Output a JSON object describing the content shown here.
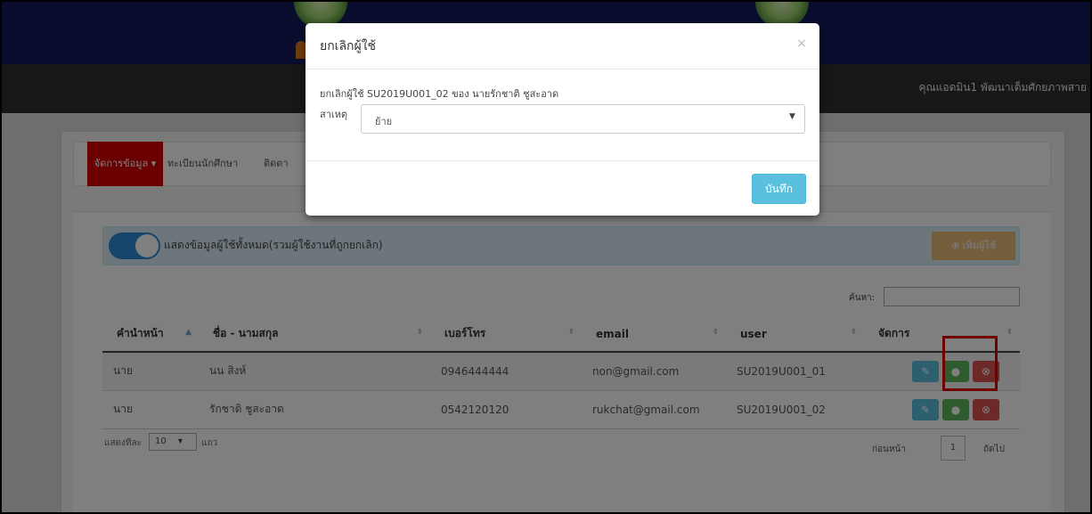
{
  "navbar": {
    "user_name": "คุณแอดมิน1 พัฒนาเต็มศักยภาพสาย"
  },
  "menu": {
    "active_label": "จัดการข้อมูล ▾",
    "items": [
      "ทะเบียนนักศึกษา",
      "ติดตา"
    ]
  },
  "toolbar": {
    "toggle_label": "แสดงข้อมูลผู้ใช้ทั้งหมด(รวมผู้ใช้งานที่ถูกยกเลิก)",
    "add_user_label": "⊕ เพิ่มผู้ใช้",
    "toggle_on": true
  },
  "search": {
    "label": "ค้นหา:",
    "value": ""
  },
  "table": {
    "columns": [
      "คำนำหน้า",
      "ชื่อ - นามสกุล",
      "เบอร์โทร",
      "email",
      "user",
      "จัดการ"
    ],
    "sort_column": "คำนำหน้า",
    "rows": [
      {
        "prefix": "นาย",
        "name": "นน สิงห์",
        "phone": "0946444444",
        "email": "non@gmail.com",
        "user": "SU2019U001_01"
      },
      {
        "prefix": "นาย",
        "name": "รักชาติ ชูสะอาด",
        "phone": "0542120120",
        "email": "rukchat@gmail.com",
        "user": "SU2019U001_02"
      }
    ]
  },
  "length": {
    "label": "แสดงทีละ",
    "value": "10",
    "unit": "แถว"
  },
  "pagination": {
    "prev": "ก่อนหน้า",
    "page": "1",
    "next": "ถัดไป"
  },
  "modal": {
    "title": "ยกเลิกผู้ใช้",
    "close": "×",
    "description": "ยกเลิกผู้ใช้ SU2019U001_02 ของ นายรักชาติ ชูสะอาด",
    "reason_label": "สาเหตุ",
    "reason_value": "ย้าย",
    "save_label": "บันทึก"
  },
  "colors": {
    "banner": "#151a5c",
    "navbar": "#2f2f2f",
    "menu_active": "#d40000",
    "toggle": "#2e8ad8",
    "add_button": "#f0ad4e",
    "edit": "#5bc0de",
    "info": "#5cb85c",
    "cancel": "#d9534f",
    "highlight": "#e00000"
  }
}
